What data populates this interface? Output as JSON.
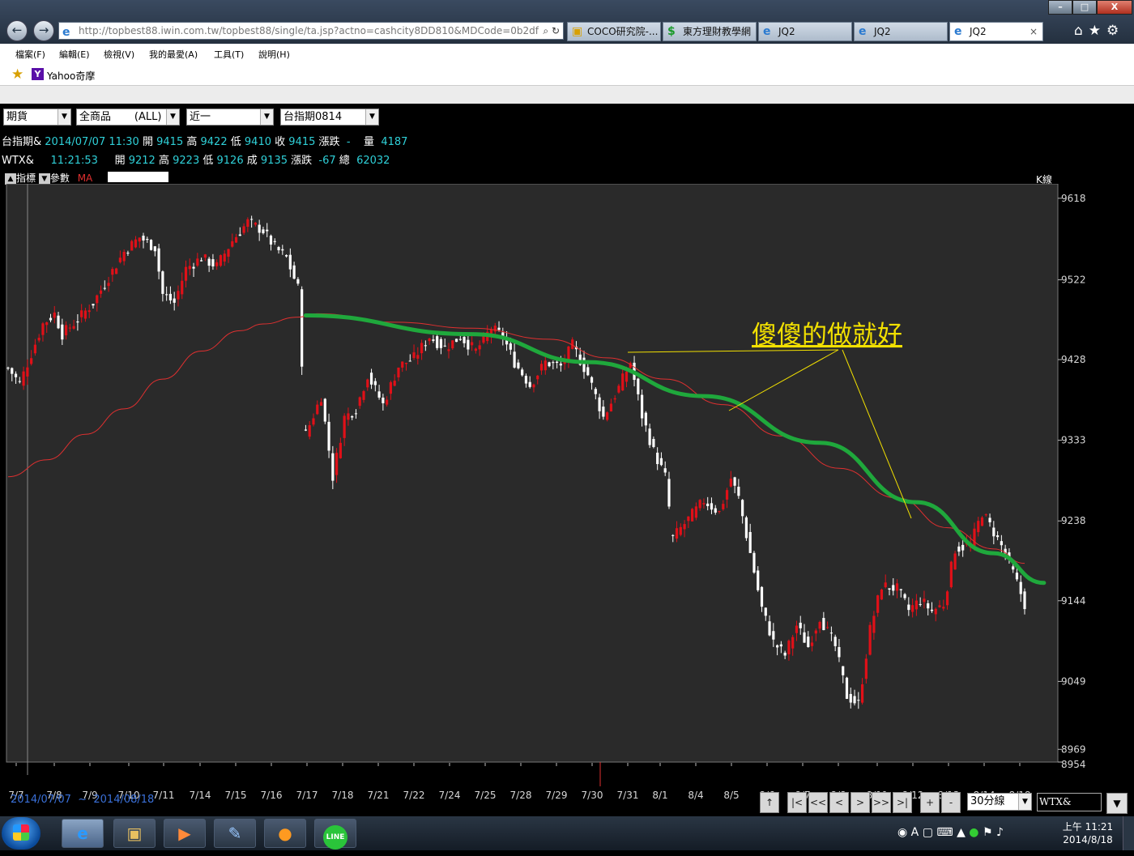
{
  "browser": {
    "address": "http://topbest88.iwin.com.tw/topbest88/single/ta.jsp?actno=cashcity8DD810&MDCode=0b2df",
    "address_icons": "⌕ ↻",
    "tabs": [
      {
        "label": "COCO研究院-...",
        "icon": "folder-icon"
      },
      {
        "label": "東方理財教學網",
        "icon": "dollar-icon"
      },
      {
        "label": "JQ2",
        "icon": "ie-icon"
      },
      {
        "label": "JQ2",
        "icon": "ie-icon"
      },
      {
        "label": "JQ2",
        "icon": "ie-icon",
        "active": true
      }
    ],
    "menu": [
      "檔案(F)",
      "編輯(E)",
      "檢視(V)",
      "我的最愛(A)",
      "工具(T)",
      "說明(H)"
    ],
    "favorites": [
      "Yahoo奇摩"
    ],
    "window_controls": [
      "–",
      "□",
      "X"
    ],
    "toolbar_icons": [
      "home-icon",
      "star-icon",
      "gear-icon"
    ]
  },
  "selectors": {
    "market": "期貨",
    "product": "全商品       (ALL)",
    "month": "近一",
    "contract": "台指期0814"
  },
  "quotes": {
    "row1": {
      "name": "台指期&",
      "date": "2014/07/07",
      "time": "11:30",
      "open_label": "開",
      "open": "9415",
      "high_label": "高",
      "high": "9422",
      "low_label": "低",
      "low": "9410",
      "close_label": "收",
      "close": "9415",
      "chg_label": "漲跌",
      "chg": "-",
      "vol_label": "量",
      "vol": "4187"
    },
    "row2": {
      "name": "WTX&",
      "time": "11:21:53",
      "open_label": "開",
      "open": "9212",
      "high_label": "高",
      "high": "9223",
      "low_label": "低",
      "low": "9126",
      "close_label": "成",
      "close": "9135",
      "chg_label": "漲跌",
      "chg": "-67",
      "vol_label": "總",
      "vol": "62032"
    }
  },
  "chart_controls": {
    "indicator": "指標",
    "params": "參數",
    "ma": "MA",
    "kline": "K線"
  },
  "chart_data": {
    "type": "candlestick",
    "title": "",
    "annotation": "傻傻的做就好",
    "y_ticks": [
      9618,
      9522,
      9428,
      9333,
      9238,
      9144,
      9049,
      8969,
      8954
    ],
    "y_range": [
      8954,
      9635
    ],
    "x_ticks": [
      "7/7",
      "7/8",
      "7/9",
      "7/10",
      "7/11",
      "7/14",
      "7/15",
      "7/16",
      "7/17",
      "7/18",
      "7/21",
      "7/22",
      "7/24",
      "7/25",
      "7/28",
      "7/29",
      "7/30",
      "7/31",
      "8/1",
      "8/4",
      "8/5",
      "8/6",
      "8/7",
      "8/8",
      "8/11",
      "8/12",
      "8/13",
      "8/14",
      "8/18"
    ],
    "price_path": [
      [
        0,
        9418
      ],
      [
        3,
        9400
      ],
      [
        6,
        9435
      ],
      [
        9,
        9470
      ],
      [
        12,
        9482
      ],
      [
        14,
        9458
      ],
      [
        18,
        9475
      ],
      [
        22,
        9495
      ],
      [
        26,
        9525
      ],
      [
        30,
        9555
      ],
      [
        34,
        9572
      ],
      [
        38,
        9560
      ],
      [
        40,
        9505
      ],
      [
        43,
        9495
      ],
      [
        46,
        9535
      ],
      [
        50,
        9548
      ],
      [
        54,
        9538
      ],
      [
        58,
        9568
      ],
      [
        62,
        9590
      ],
      [
        66,
        9580
      ],
      [
        69,
        9560
      ],
      [
        72,
        9548
      ],
      [
        75,
        9512
      ],
      [
        77,
        9340
      ],
      [
        81,
        9385
      ],
      [
        84,
        9290
      ],
      [
        87,
        9360
      ],
      [
        90,
        9370
      ],
      [
        93,
        9410
      ],
      [
        97,
        9375
      ],
      [
        101,
        9420
      ],
      [
        105,
        9430
      ],
      [
        109,
        9455
      ],
      [
        113,
        9442
      ],
      [
        117,
        9455
      ],
      [
        121,
        9438
      ],
      [
        125,
        9465
      ],
      [
        128,
        9455
      ],
      [
        131,
        9425
      ],
      [
        135,
        9398
      ],
      [
        139,
        9425
      ],
      [
        143,
        9420
      ],
      [
        146,
        9445
      ],
      [
        150,
        9410
      ],
      [
        154,
        9360
      ],
      [
        158,
        9395
      ],
      [
        161,
        9425
      ],
      [
        164,
        9362
      ],
      [
        167,
        9320
      ],
      [
        170,
        9290
      ],
      [
        172,
        9218
      ],
      [
        176,
        9240
      ],
      [
        180,
        9262
      ],
      [
        184,
        9248
      ],
      [
        187,
        9288
      ],
      [
        189,
        9265
      ],
      [
        192,
        9200
      ],
      [
        195,
        9135
      ],
      [
        198,
        9095
      ],
      [
        201,
        9080
      ],
      [
        204,
        9115
      ],
      [
        207,
        9090
      ],
      [
        210,
        9125
      ],
      [
        214,
        9090
      ],
      [
        217,
        9032
      ],
      [
        220,
        9022
      ],
      [
        223,
        9110
      ],
      [
        226,
        9162
      ],
      [
        230,
        9158
      ],
      [
        233,
        9133
      ],
      [
        236,
        9145
      ],
      [
        239,
        9132
      ],
      [
        242,
        9140
      ],
      [
        245,
        9205
      ],
      [
        249,
        9210
      ],
      [
        252,
        9248
      ],
      [
        255,
        9225
      ],
      [
        258,
        9200
      ],
      [
        261,
        9165
      ],
      [
        263,
        9140
      ]
    ],
    "ma": [
      [
        0,
        9290
      ],
      [
        10,
        9310
      ],
      [
        20,
        9340
      ],
      [
        30,
        9370
      ],
      [
        40,
        9405
      ],
      [
        50,
        9438
      ],
      [
        60,
        9462
      ],
      [
        66,
        9470
      ],
      [
        75,
        9478
      ],
      [
        80,
        9482
      ],
      [
        100,
        9472
      ],
      [
        120,
        9465
      ],
      [
        140,
        9452
      ],
      [
        155,
        9430
      ],
      [
        170,
        9405
      ],
      [
        185,
        9375
      ],
      [
        200,
        9338
      ],
      [
        215,
        9300
      ],
      [
        230,
        9265
      ],
      [
        243,
        9230
      ],
      [
        255,
        9205
      ],
      [
        263,
        9188
      ]
    ],
    "trend_curve": [
      [
        77,
        9480
      ],
      [
        120,
        9458
      ],
      [
        150,
        9425
      ],
      [
        180,
        9385
      ],
      [
        210,
        9330
      ],
      [
        235,
        9260
      ],
      [
        255,
        9200
      ],
      [
        268,
        9165
      ]
    ],
    "colors": {
      "up": "#e01018",
      "down": "#ffffff",
      "ma": "#e03030",
      "trend": "#1fa83c",
      "annotation": "#f2e000",
      "plot_bg": "#2a2a2a",
      "axis_text": "#d8d8d8"
    }
  },
  "footer": {
    "date_start": "2014/07/07",
    "date_sep": "~",
    "date_end": "2014/08/18",
    "nav_buttons": [
      "↑",
      "|<",
      "<<",
      "<",
      ">",
      ">>",
      ">|",
      "+",
      "-"
    ],
    "period": "30分線",
    "symbol": "WTX&",
    "drop": "▼"
  },
  "taskbar": {
    "apps": [
      "ie-icon",
      "folder-icon",
      "media-icon",
      "paint-icon",
      "chat-icon",
      "line-icon"
    ],
    "line_label": "LINE",
    "clock_time": "上午 11:21",
    "clock_date": "2014/8/18",
    "tray_text": "A"
  }
}
